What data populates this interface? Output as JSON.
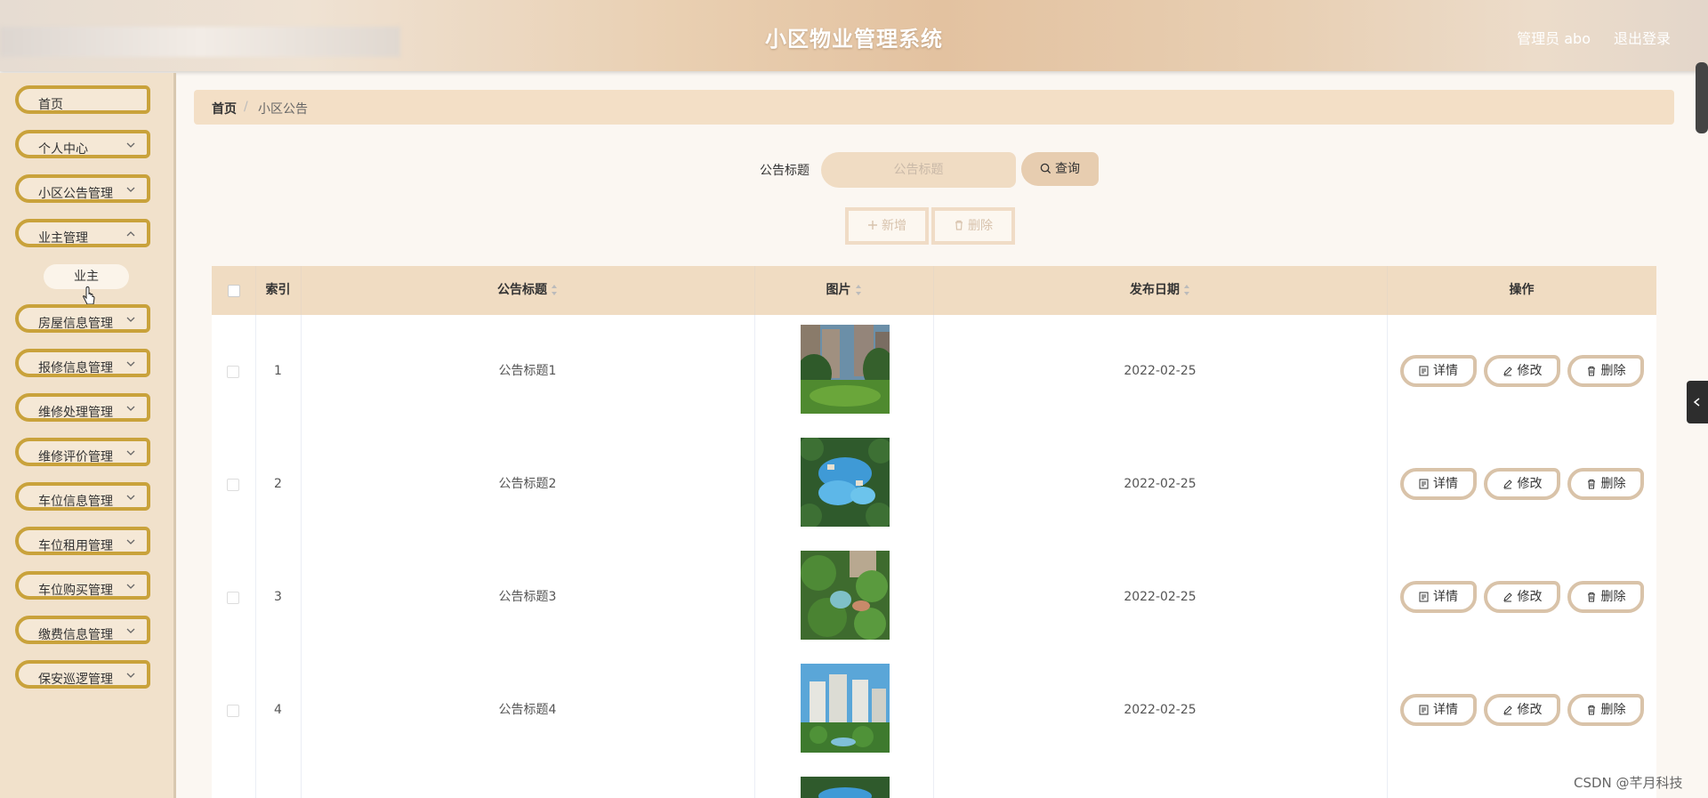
{
  "header": {
    "title": "小区物业管理系统",
    "user": "管理员 abo",
    "logout": "退出登录"
  },
  "sidebar": {
    "items": [
      {
        "label": "首页",
        "has_chevron": false
      },
      {
        "label": "个人中心",
        "has_chevron": true
      },
      {
        "label": "小区公告管理",
        "has_chevron": true
      },
      {
        "label": "业主管理",
        "has_chevron": true
      },
      {
        "label": "房屋信息管理",
        "has_chevron": true
      },
      {
        "label": "报修信息管理",
        "has_chevron": true
      },
      {
        "label": "维修处理管理",
        "has_chevron": true
      },
      {
        "label": "维修评价管理",
        "has_chevron": true
      },
      {
        "label": "车位信息管理",
        "has_chevron": true
      },
      {
        "label": "车位租用管理",
        "has_chevron": true
      },
      {
        "label": "车位购买管理",
        "has_chevron": true
      },
      {
        "label": "缴费信息管理",
        "has_chevron": true
      },
      {
        "label": "保安巡逻管理",
        "has_chevron": true
      }
    ],
    "submenu_item": "业主"
  },
  "breadcrumb": {
    "home": "首页",
    "separator": "/",
    "current": "小区公告"
  },
  "search": {
    "label": "公告标题",
    "placeholder": "公告标题",
    "button": "查询"
  },
  "actions": {
    "add": "新增",
    "delete": "删除"
  },
  "table": {
    "headers": {
      "index": "索引",
      "title": "公告标题",
      "image": "图片",
      "date": "发布日期",
      "ops": "操作"
    },
    "rows": [
      {
        "index": "1",
        "title": "公告标题1",
        "date": "2022-02-25"
      },
      {
        "index": "2",
        "title": "公告标题2",
        "date": "2022-02-25"
      },
      {
        "index": "3",
        "title": "公告标题3",
        "date": "2022-02-25"
      },
      {
        "index": "4",
        "title": "公告标题4",
        "date": "2022-02-25"
      }
    ],
    "row_actions": {
      "detail": "详情",
      "edit": "修改",
      "delete": "删除"
    }
  },
  "watermark": "CSDN @芊月科技",
  "colors": {
    "sidebar_border": "#c9a23b",
    "header_bg": "#e3c2a0",
    "table_header_bg": "#f0dcc2",
    "action_border": "#d9c3a9"
  }
}
